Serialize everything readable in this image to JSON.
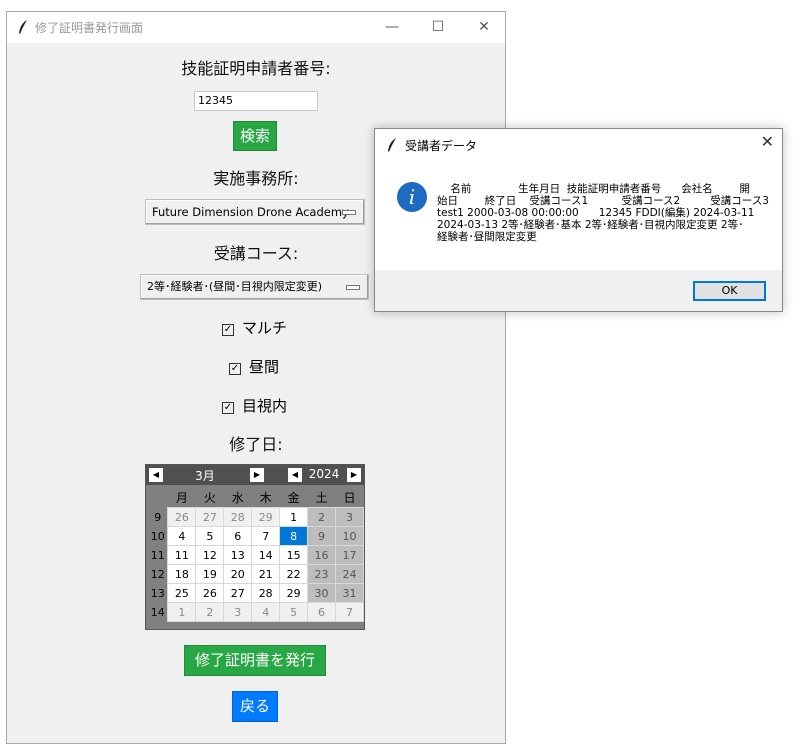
{
  "window": {
    "title": "修了証明書発行画面",
    "minimize": "—",
    "maximize": "☐",
    "close": "✕"
  },
  "form": {
    "applicant_label": "技能証明申請者番号:",
    "applicant_value": "12345",
    "search_label": "検索",
    "office_label": "実施事務所:",
    "office_value": "Future Dimension Drone Academy",
    "course_label": "受講コース:",
    "course_value": "2等･経験者･(昼間･目視内限定変更)",
    "checks": [
      {
        "label": "マルチ",
        "checked": true
      },
      {
        "label": "昼間",
        "checked": true
      },
      {
        "label": "目視内",
        "checked": true
      }
    ],
    "check_mark": "☑",
    "date_label": "修了日:",
    "issue_label": "修了証明書を発行",
    "back_label": "戻る"
  },
  "calendar": {
    "month": "3月",
    "year": "2024",
    "prev": "◀",
    "next": "▶",
    "weekdays": [
      "月",
      "火",
      "水",
      "木",
      "金",
      "土",
      "日"
    ],
    "weeks": [
      {
        "no": "9",
        "days": [
          "26",
          "27",
          "28",
          "29",
          "1",
          "2",
          "3"
        ]
      },
      {
        "no": "10",
        "days": [
          "4",
          "5",
          "6",
          "7",
          "8",
          "9",
          "10"
        ]
      },
      {
        "no": "11",
        "days": [
          "11",
          "12",
          "13",
          "14",
          "15",
          "16",
          "17"
        ]
      },
      {
        "no": "12",
        "days": [
          "18",
          "19",
          "20",
          "21",
          "22",
          "23",
          "24"
        ]
      },
      {
        "no": "13",
        "days": [
          "25",
          "26",
          "27",
          "28",
          "29",
          "30",
          "31"
        ]
      },
      {
        "no": "14",
        "days": [
          "1",
          "2",
          "3",
          "4",
          "5",
          "6",
          "7"
        ]
      }
    ],
    "selected": "8"
  },
  "dialog": {
    "title": "受講者データ",
    "close": "✕",
    "icon": "i",
    "message": "    名前              生年月日  技能証明申請者番号      会社名        開\n始日        終了日    受講コース1          受講コース2         受講コース3\ntest1 2000-03-08 00:00:00      12345 FDDI(編集) 2024-03-11\n2024-03-13 2等･経験者･基本 2等･経験者･目視内限定変更 2等･\n経験者･昼間限定変更",
    "ok": "OK"
  },
  "colors": {
    "green": "#28a745",
    "blue": "#007bff",
    "selected_day": "#0078d7"
  }
}
